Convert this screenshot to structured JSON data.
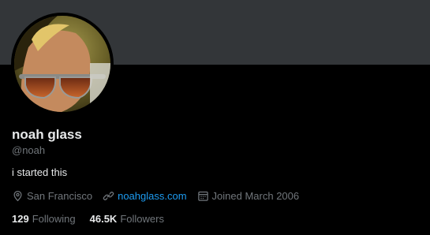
{
  "profile": {
    "display_name": "noah glass",
    "handle": "@noah",
    "bio": "i started this",
    "location": "San Francisco",
    "website": "noahglass.com",
    "joined": "Joined March 2006",
    "following_count": "129",
    "following_label": "Following",
    "followers_count": "46.5K",
    "followers_label": "Followers"
  },
  "icons": {
    "location": "location-pin-icon",
    "website": "link-icon",
    "joined": "calendar-icon"
  },
  "colors": {
    "background": "#000000",
    "banner": "#333639",
    "link": "#1d9bf0",
    "secondary_text": "#71767b",
    "primary_text": "#e7e9ea"
  }
}
